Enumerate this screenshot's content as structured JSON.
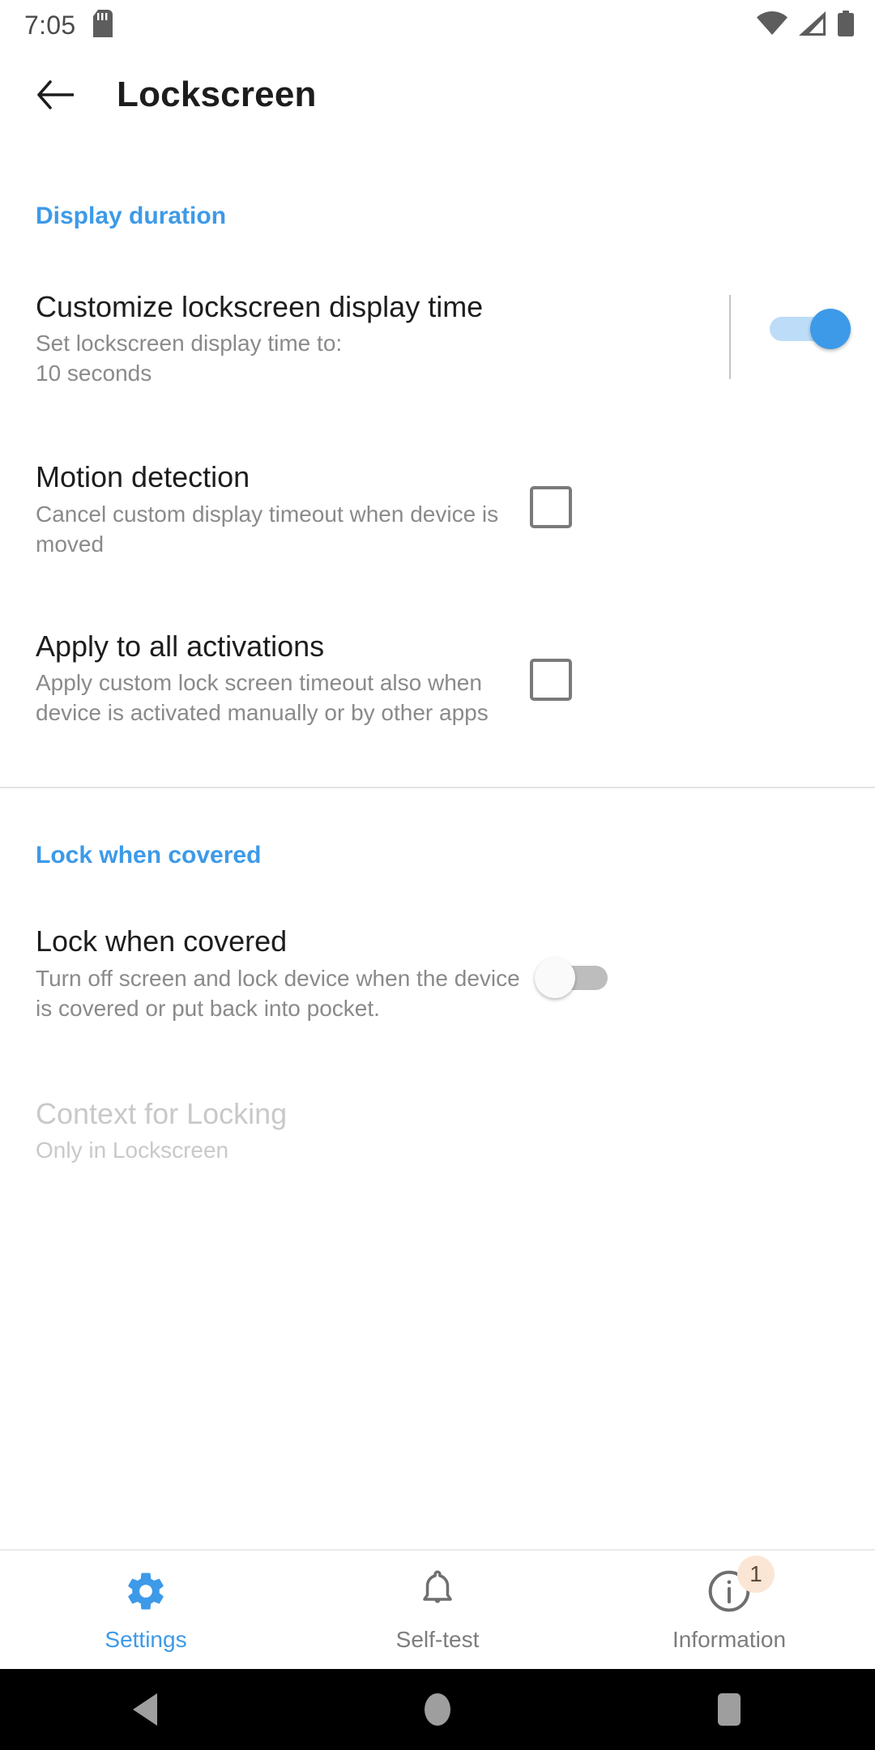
{
  "status_bar": {
    "time": "7:05",
    "icons": [
      "sd-card-icon",
      "wifi-icon",
      "cellular-signal-icon",
      "battery-icon"
    ]
  },
  "app_bar": {
    "back_label": "Back",
    "title": "Lockscreen"
  },
  "colors": {
    "accent": "#3d9ae8",
    "title_text": "#1d1d1d",
    "subtitle_text": "#8a8a8a",
    "disabled_text": "#c9c9c9",
    "switch_on_track": "#bddcf7",
    "switch_on_thumb": "#3d9ae8",
    "switch_off_track": "#bdbdbd",
    "switch_off_thumb": "#fafafa",
    "badge_background": "#fbe6d6",
    "badge_text": "#5c4a33"
  },
  "sections": [
    {
      "header": "Display duration",
      "rows": [
        {
          "title": "Customize lockscreen display time",
          "subtitle": "Set lockscreen display time to:\n10 seconds",
          "control": "switch",
          "state": "on",
          "has_divider": true
        },
        {
          "title": "Motion detection",
          "subtitle": "Cancel custom display timeout when device is moved",
          "control": "checkbox",
          "state": "unchecked",
          "has_divider": false
        },
        {
          "title": "Apply to all activations",
          "subtitle": "Apply custom lock screen timeout also when device is activated manually or by other apps",
          "control": "checkbox",
          "state": "unchecked",
          "has_divider": false
        }
      ]
    },
    {
      "header": "Lock when covered",
      "rows": [
        {
          "title": "Lock when covered",
          "subtitle": "Turn off screen and lock device when the device is covered or put back into pocket.",
          "control": "switch",
          "state": "off",
          "has_divider": false
        },
        {
          "title": "Context for Locking",
          "subtitle": "Only in Lockscreen",
          "control": "none",
          "state": "disabled",
          "has_divider": false
        }
      ]
    }
  ],
  "bottom_nav": {
    "items": [
      {
        "label": "Settings",
        "icon": "gear-icon",
        "active": true,
        "badge": ""
      },
      {
        "label": "Self-test",
        "icon": "bell-icon",
        "active": false,
        "badge": ""
      },
      {
        "label": "Information",
        "icon": "info-icon",
        "active": false,
        "badge": "1"
      }
    ]
  },
  "system_nav": {
    "back": "back-triangle-icon",
    "home": "home-circle-icon",
    "recents": "recents-square-icon"
  }
}
